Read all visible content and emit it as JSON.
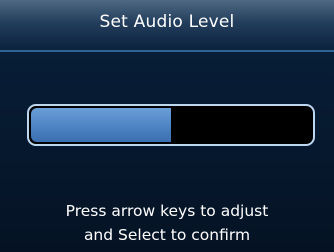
{
  "dialog": {
    "title": "Set Audio Level"
  },
  "audio_level": {
    "fraction": 0.5
  },
  "instructions": {
    "line1": "Press arrow keys to adjust",
    "line2": "and Select to confirm"
  },
  "colors": {
    "background": "#061528",
    "title_bar": "#233e5c",
    "meter_fill": "#5a90cc",
    "meter_border": "#bdd7f0"
  }
}
